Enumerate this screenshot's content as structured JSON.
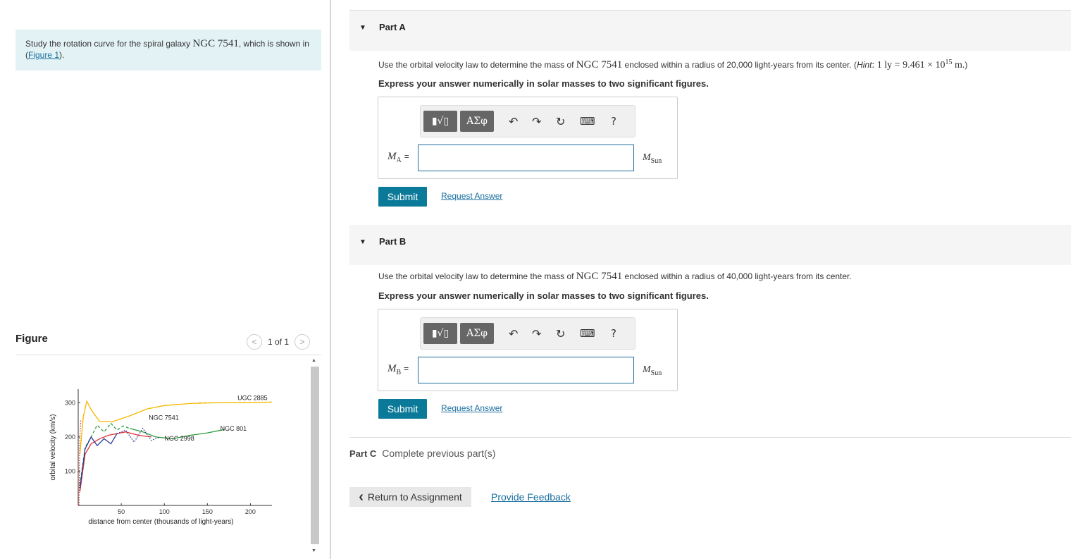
{
  "intro": {
    "text_before": "Study the rotation curve for the spiral galaxy ",
    "galaxy": "NGC 7541",
    "text_mid": ", which is shown in (",
    "figure_link": "Figure 1",
    "text_after": ")."
  },
  "figure": {
    "title": "Figure",
    "pager": "1 of 1",
    "prev_icon": "chevron-left",
    "next_icon": "chevron-right"
  },
  "chart_data": {
    "type": "line",
    "xlabel": "distance from center (thousands of light-years)",
    "ylabel": "orbital velocity (km/s)",
    "x_ticks": [
      "50",
      "100",
      "150",
      "200"
    ],
    "y_ticks": [
      "100",
      "200",
      "300"
    ],
    "xlim": [
      0,
      225
    ],
    "ylim": [
      0,
      340
    ],
    "series": [
      {
        "name": "UGC 2885",
        "color": "#f5b800",
        "style": "solid",
        "x": [
          2,
          6,
          10,
          15,
          25,
          40,
          60,
          80,
          100,
          130,
          160,
          190,
          225
        ],
        "y": [
          150,
          260,
          305,
          280,
          245,
          245,
          262,
          282,
          292,
          298,
          300,
          300,
          302
        ]
      },
      {
        "name": "NGC 7541",
        "color": "#2a9d3a",
        "style": "dashed",
        "x": [
          2,
          8,
          15,
          22,
          30,
          38,
          45,
          52,
          60
        ],
        "y": [
          60,
          170,
          200,
          235,
          215,
          240,
          220,
          232,
          225
        ]
      },
      {
        "name": "NGC 801",
        "color": "#2a9d3a",
        "style": "solid",
        "x": [
          60,
          75,
          90,
          110,
          130,
          150,
          170
        ],
        "y": [
          225,
          215,
          200,
          195,
          205,
          212,
          222
        ]
      },
      {
        "name": "NGC 2998",
        "color": "#e03030",
        "style": "solid",
        "x": [
          2,
          8,
          15,
          25,
          35,
          45,
          55,
          70,
          85
        ],
        "y": [
          40,
          150,
          180,
          195,
          205,
          210,
          215,
          205,
          200
        ]
      },
      {
        "name": "",
        "color": "#2b3a9a",
        "style": "solid",
        "x": [
          2,
          8,
          15,
          22,
          30,
          38,
          45
        ],
        "y": [
          50,
          165,
          200,
          175,
          195,
          180,
          210
        ]
      },
      {
        "name": "",
        "color": "#2b3a9a",
        "style": "dotted",
        "x": [
          45,
          55,
          65,
          75,
          85,
          95
        ],
        "y": [
          210,
          220,
          185,
          225,
          190,
          200
        ]
      },
      {
        "name": "",
        "color": "#e03030",
        "style": "dotted",
        "x": [
          1,
          1.5,
          2,
          3
        ],
        "y": [
          0,
          100,
          200,
          250
        ]
      },
      {
        "name": "",
        "color": "#f5b800",
        "style": "dashed",
        "x": [
          140,
          170,
          200,
          225
        ],
        "y": [
          300,
          300,
          301,
          302
        ]
      }
    ]
  },
  "partA": {
    "label": "Part A",
    "q_before": "Use the orbital velocity law to determine the mass of ",
    "q_galaxy": "NGC 7541",
    "q_mid": " enclosed within a radius of 20,000 light-years from its center. (",
    "q_hint": "Hint",
    "q_hint_eq": ": 1 ly = 9.461 × 10",
    "q_hint_exp": "15",
    "q_hint_unit": " m.",
    "q_end": ")",
    "instruction": "Express your answer numerically in solar masses to two significant figures.",
    "var": "M",
    "var_sub": "A",
    "eq": "=",
    "input_value": "",
    "unit": "M",
    "unit_sub": "Sun",
    "submit": "Submit",
    "request": "Request Answer"
  },
  "partB": {
    "label": "Part B",
    "q_before": "Use the orbital velocity law to determine the mass of ",
    "q_galaxy": "NGC 7541",
    "q_after": " enclosed within a radius of 40,000 light-years from its center.",
    "instruction": "Express your answer numerically in solar masses to two significant figures.",
    "var": "M",
    "var_sub": "B",
    "eq": "=",
    "input_value": "",
    "unit": "M",
    "unit_sub": "Sun",
    "submit": "Submit",
    "request": "Request Answer"
  },
  "toolbar": {
    "templates_label": "▮√▯",
    "symbols_label": "ΑΣφ",
    "undo": "↶",
    "redo": "↷",
    "reset": "↻",
    "keyboard": "⌨",
    "help": "?"
  },
  "partC": {
    "label": "Part C",
    "text": "Complete previous part(s)"
  },
  "footer": {
    "return_icon": "‹",
    "return": "Return to Assignment",
    "feedback": "Provide Feedback"
  }
}
